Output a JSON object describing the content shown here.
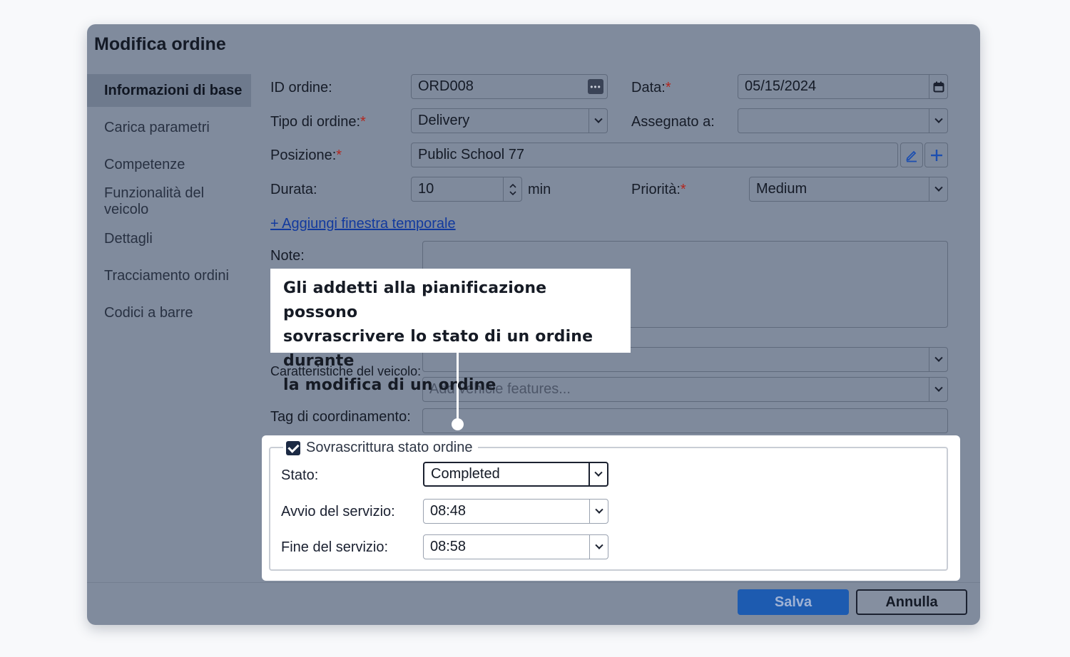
{
  "dialog": {
    "title": "Modifica ordine",
    "sidebar": {
      "items": [
        {
          "label": "Informazioni di base"
        },
        {
          "label": "Carica parametri"
        },
        {
          "label": "Competenze"
        },
        {
          "label": "Funzionalità del veicolo"
        },
        {
          "label": "Dettagli"
        },
        {
          "label": "Tracciamento ordini"
        },
        {
          "label": "Codici a barre"
        }
      ]
    },
    "form": {
      "order_id": {
        "label": "ID ordine:",
        "value": "ORD008"
      },
      "date": {
        "label": "Data:",
        "required_mark": "*",
        "value": "05/15/2024"
      },
      "order_type": {
        "label": "Tipo di ordine:",
        "required_mark": "*",
        "value": "Delivery"
      },
      "assigned_to": {
        "label": "Assegnato a:",
        "value": ""
      },
      "position": {
        "label": "Posizione:",
        "required_mark": "*",
        "value": "Public School 77"
      },
      "duration": {
        "label": "Durata:",
        "value": "10",
        "unit": "min"
      },
      "priority": {
        "label": "Priorità:",
        "required_mark": "*",
        "value": "Medium"
      },
      "add_time_window_link": "+ Aggiungi finestra temporale",
      "notes": {
        "label": "Note:"
      },
      "vehicle_features": {
        "label": "Caratteristiche del veicolo:",
        "placeholder": "Add vehicle features..."
      },
      "coordination_tag": {
        "label": "Tag di coordinamento:"
      }
    },
    "override": {
      "legend": "Sovrascrittura stato ordine",
      "checked": true,
      "status": {
        "label": "Stato:",
        "value": "Completed"
      },
      "service_start": {
        "label": "Avvio del servizio:",
        "value": "08:48"
      },
      "service_end": {
        "label": "Fine del servizio:",
        "value": "08:58"
      }
    },
    "footer": {
      "save_label": "Salva",
      "cancel_label": "Annulla"
    }
  },
  "callout": {
    "text_line1": "Gli addetti alla pianificazione possono",
    "text_line2": "sovrascrivere lo stato di un ordine durante",
    "text_line3": "la modifica di un ordine"
  }
}
